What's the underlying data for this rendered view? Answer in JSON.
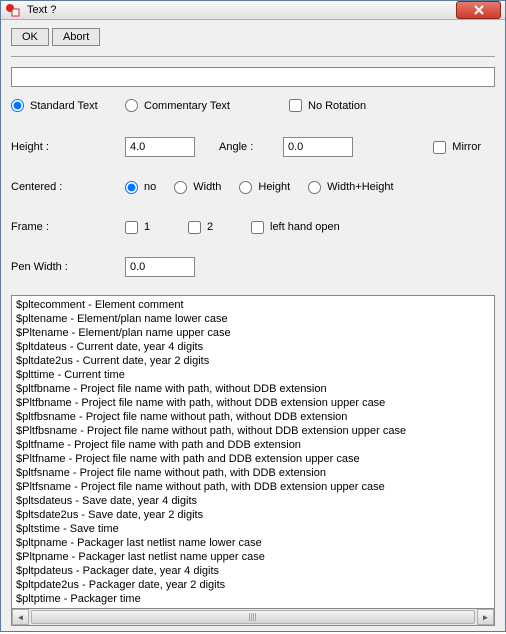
{
  "window": {
    "title": "Text ?"
  },
  "buttons": {
    "ok": "OK",
    "abort": "Abort"
  },
  "main_input": "",
  "type_row": {
    "standard": "Standard Text",
    "commentary": "Commentary Text",
    "no_rotation": "No Rotation"
  },
  "height_row": {
    "label": "Height :",
    "value": "4.0",
    "angle_label": "Angle :",
    "angle_value": "0.0",
    "mirror": "Mirror"
  },
  "centered_row": {
    "label": "Centered :",
    "no": "no",
    "width": "Width",
    "height": "Height",
    "wh": "Width+Height"
  },
  "frame_row": {
    "label": "Frame :",
    "one": "1",
    "two": "2",
    "lefthand": "left hand open"
  },
  "pen_row": {
    "label": "Pen Width :",
    "value": "0.0"
  },
  "list": [
    "$pltecomment - Element comment",
    "$pltename - Element/plan name lower case",
    "$Pltename - Element/plan name upper case",
    "$pltdateus - Current date, year 4 digits",
    "$pltdate2us - Current date, year 2 digits",
    "$plttime - Current time",
    "$pltfbname - Project file name with path, without DDB extension",
    "$Pltfbname - Project file name with path, without DDB extension upper case",
    "$pltfbsname - Project file name without path, without DDB extension",
    "$Pltfbsname - Project file name without path, without DDB extension upper case",
    "$pltfname - Project file name with path and DDB extension",
    "$Pltfname - Project file name with path and DDB extension upper case",
    "$pltfsname - Project file name without path, with DDB extension",
    "$Pltfsname - Project file name without path, with DDB extension upper case",
    "$pltsdateus - Save date, year 4 digits",
    "$pltsdate2us - Save date, year 2 digits",
    "$pltstime - Save time",
    "$pltpname - Packager last netlist name lower case",
    "$Pltpname - Packager last netlist name upper case",
    "$pltpdateus - Packager date, year 4 digits",
    "$pltpdate2us - Packager date, year 2 digits",
    "$pltptime - Packager time"
  ]
}
